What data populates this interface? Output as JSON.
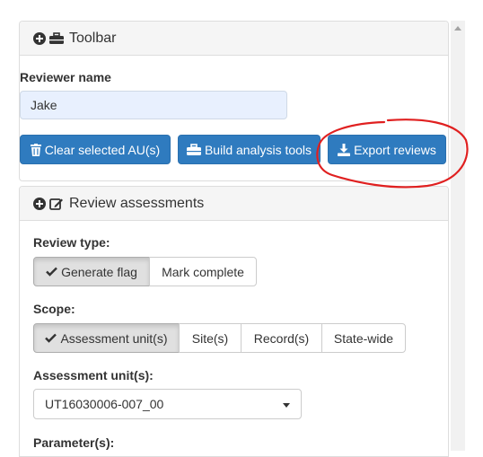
{
  "toolbar": {
    "title": "Toolbar",
    "reviewer_label": "Reviewer name",
    "reviewer_value": "Jake",
    "buttons": {
      "clear": "Clear selected AU(s)",
      "build": "Build analysis tools",
      "export": "Export reviews"
    }
  },
  "review": {
    "title": "Review assessments",
    "review_type_label": "Review type:",
    "review_type_options": [
      "Generate flag",
      "Mark complete"
    ],
    "review_type_selected": "Generate flag",
    "scope_label": "Scope:",
    "scope_options": [
      "Assessment unit(s)",
      "Site(s)",
      "Record(s)",
      "State-wide"
    ],
    "scope_selected": "Assessment unit(s)",
    "assessment_units_label": "Assessment unit(s):",
    "assessment_units_value": "UT16030006-007_00",
    "parameters_label": "Parameter(s):"
  },
  "colors": {
    "primary": "#2f7bbf",
    "annotation": "#e02020"
  },
  "icons": {
    "toolbar_plus": "plus-circle-icon",
    "toolbar_briefcase": "toolbox-icon",
    "clear": "trash-icon",
    "build": "toolbox-icon",
    "export": "download-icon",
    "review_plus": "plus-circle-icon",
    "review_edit": "edit-icon",
    "checkmark": "check-icon"
  }
}
